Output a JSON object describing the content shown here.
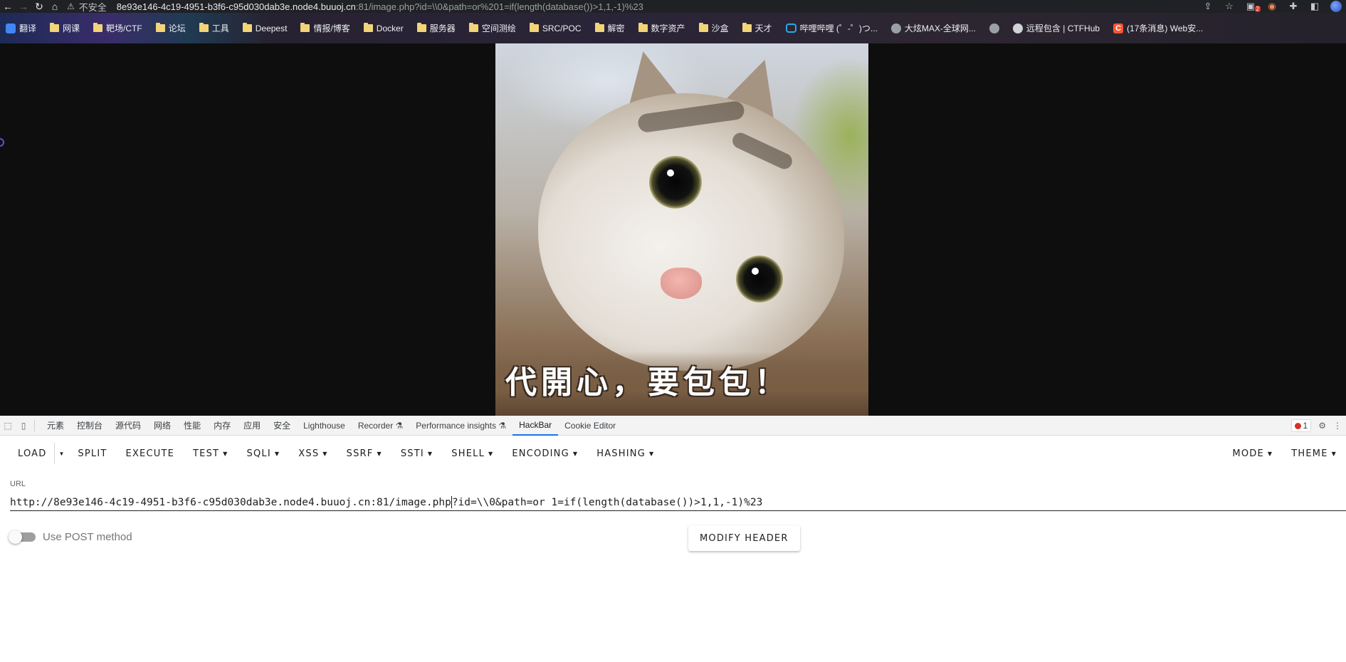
{
  "browser": {
    "insecure_label": "不安全",
    "url_host": "8e93e146-4c19-4951-b3f6-c95d030dab3e.node4.buuoj.cn",
    "url_rest": ":81/image.php?id=\\\\0&path=or%201=if(length(database())>1,1,-1)%23",
    "extension_badge": "2"
  },
  "bookmarks": [
    {
      "label": "翻译",
      "icon": "translate-icon"
    },
    {
      "label": "网课",
      "icon": "folder-icon"
    },
    {
      "label": "靶场/CTF",
      "icon": "folder-icon"
    },
    {
      "label": "论坛",
      "icon": "folder-icon"
    },
    {
      "label": "工具",
      "icon": "folder-icon"
    },
    {
      "label": "Deepest",
      "icon": "folder-icon"
    },
    {
      "label": "情报/博客",
      "icon": "folder-icon"
    },
    {
      "label": "Docker",
      "icon": "folder-icon"
    },
    {
      "label": "服务器",
      "icon": "folder-icon"
    },
    {
      "label": "空间测绘",
      "icon": "folder-icon"
    },
    {
      "label": "SRC/POC",
      "icon": "folder-icon"
    },
    {
      "label": "解密",
      "icon": "folder-icon"
    },
    {
      "label": "数字资产",
      "icon": "folder-icon"
    },
    {
      "label": "沙盒",
      "icon": "folder-icon"
    },
    {
      "label": "天才",
      "icon": "folder-icon"
    },
    {
      "label": "哔哩哔哩 (゜-゜)つ...",
      "icon": "bilibili-icon"
    },
    {
      "label": "大炫MAX-全球网...",
      "icon": "globe-icon"
    },
    {
      "label": "",
      "icon": "globe-icon"
    },
    {
      "label": "远程包含 | CTFHub",
      "icon": "ctfhub-icon"
    },
    {
      "label": "(17条消息) Web安...",
      "icon": "csdn-icon"
    }
  ],
  "page": {
    "image_caption": "代開心，要包包！"
  },
  "devtools": {
    "tabs": [
      "元素",
      "控制台",
      "源代码",
      "网络",
      "性能",
      "内存",
      "应用",
      "安全",
      "Lighthouse",
      "Recorder ⚗",
      "Performance insights ⚗",
      "HackBar",
      "Cookie Editor"
    ],
    "active_tab": "HackBar",
    "error_count": "1"
  },
  "hackbar": {
    "menu": {
      "load": "LOAD",
      "split": "SPLIT",
      "execute": "EXECUTE",
      "test": "TEST",
      "sqli": "SQLI",
      "xss": "XSS",
      "ssrf": "SSRF",
      "ssti": "SSTI",
      "shell": "SHELL",
      "encoding": "ENCODING",
      "hashing": "HASHING",
      "mode": "MODE",
      "theme": "THEME"
    },
    "url_label": "URL",
    "url_before_caret": "http://8e93e146-4c19-4951-b3f6-c95d030dab3e.node4.buuoj.cn:81/image.php",
    "url_after_caret": "?id=\\\\0&path=or 1=if(length(database())>1,1,-1)%23",
    "post_toggle_label": "Use POST method",
    "post_enabled": false,
    "modify_header": "MODIFY HEADER"
  }
}
